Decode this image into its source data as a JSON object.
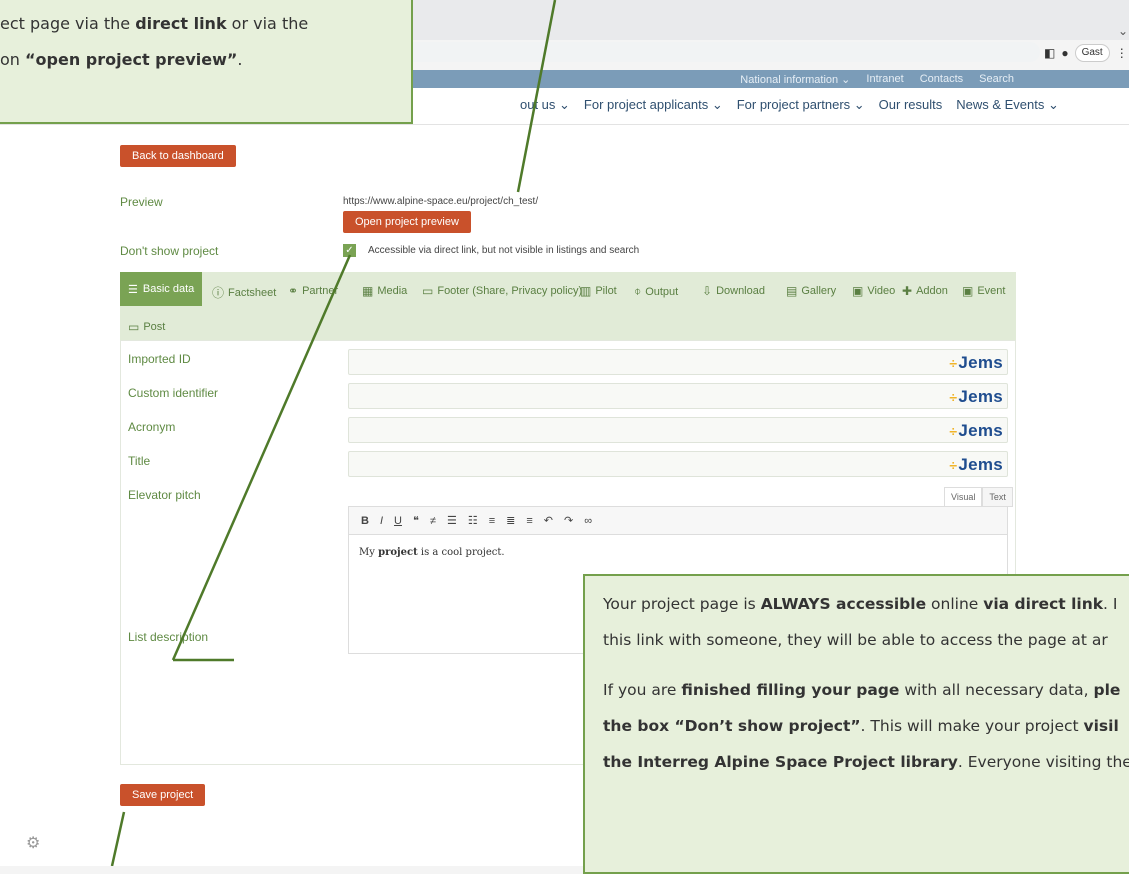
{
  "browser": {
    "profile_label": "Gast"
  },
  "site": {
    "utility_links": [
      "National information ⌄",
      "Intranet",
      "Contacts",
      "Search"
    ],
    "main_nav": [
      "out us ⌄",
      "For project applicants ⌄",
      "For project partners ⌄",
      "Our results",
      "News & Events ⌄"
    ]
  },
  "page": {
    "back_button": "Back to dashboard",
    "preview_label": "Preview",
    "preview_url": "https://www.alpine-space.eu/project/ch_test/",
    "open_preview_button": "Open project preview",
    "dont_show_label": "Don't show project",
    "dont_show_text": "Accessible via direct link, but not visible in listings and search",
    "tabs": [
      "Basic data",
      "Factsheet",
      "Partner",
      "Media",
      "Footer (Share, Privacy policy)",
      "Pilot",
      "Output",
      "Download",
      "Gallery",
      "Video",
      "Addon",
      "Event",
      "Post"
    ],
    "fields": [
      "Imported ID",
      "Custom identifier",
      "Acronym",
      "Title",
      "Elevator pitch",
      "List description"
    ],
    "jems": "Jems",
    "editor_tab_visual": "Visual",
    "editor_tab_text": "Text",
    "editor_text_pre": "My ",
    "editor_text_bold": "project",
    "editor_text_post": " is a cool project.",
    "save_button": "Save project"
  },
  "callout_top": {
    "line1_a": "ect page via the ",
    "line1_b": "direct link",
    "line1_c": " or via the",
    "line2_a": "on ",
    "line2_b": "“open project preview”",
    "line2_c": "."
  },
  "callout_bottom": {
    "p1_a": "Your project page is ",
    "p1_b": "ALWAYS accessible",
    "p1_c": " online ",
    "p1_d": "via direct link",
    "p1_e": ". I",
    "p1_line2": "this link with someone, they will be able to access the page at ar",
    "p2_a": "If you are ",
    "p2_b": "finished filling your page",
    "p2_c": " with all necessary data, ",
    "p2_d": "ple",
    "p2_line2_a": "the box “Don’t show project”",
    "p2_line2_b": ". This will make your project ",
    "p2_line2_c": "visil",
    "p2_line3_a": "the Interreg Alpine Space Project library",
    "p2_line3_b": ". Everyone visiting the"
  }
}
